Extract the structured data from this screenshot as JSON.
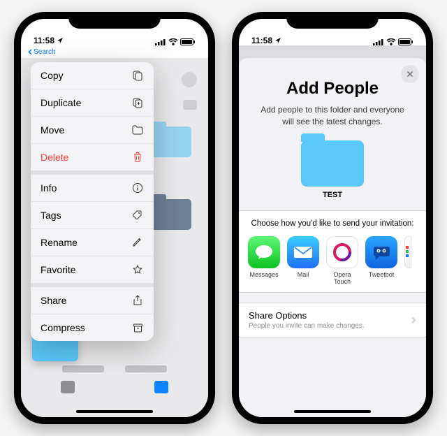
{
  "status": {
    "time": "11:58",
    "search": "Search"
  },
  "context_menu": {
    "groups": [
      [
        {
          "label": "Copy",
          "icon": "copy"
        },
        {
          "label": "Duplicate",
          "icon": "duplicate"
        },
        {
          "label": "Move",
          "icon": "folder"
        },
        {
          "label": "Delete",
          "icon": "trash",
          "destructive": true
        }
      ],
      [
        {
          "label": "Info",
          "icon": "info"
        },
        {
          "label": "Tags",
          "icon": "tag"
        },
        {
          "label": "Rename",
          "icon": "pencil"
        },
        {
          "label": "Favorite",
          "icon": "star"
        }
      ],
      [
        {
          "label": "Share",
          "icon": "share"
        },
        {
          "label": "Compress",
          "icon": "archive"
        }
      ]
    ]
  },
  "add_people": {
    "title": "Add People",
    "subtitle": "Add people to this folder and everyone will see the latest changes.",
    "folder_name": "TEST",
    "send_title": "Choose how you'd like to send your invitation:",
    "apps": [
      {
        "name": "Messages"
      },
      {
        "name": "Mail"
      },
      {
        "name": "Opera Touch"
      },
      {
        "name": "Tweetbot"
      }
    ],
    "options": {
      "title": "Share Options",
      "subtitle": "People you invite can make changes."
    }
  }
}
